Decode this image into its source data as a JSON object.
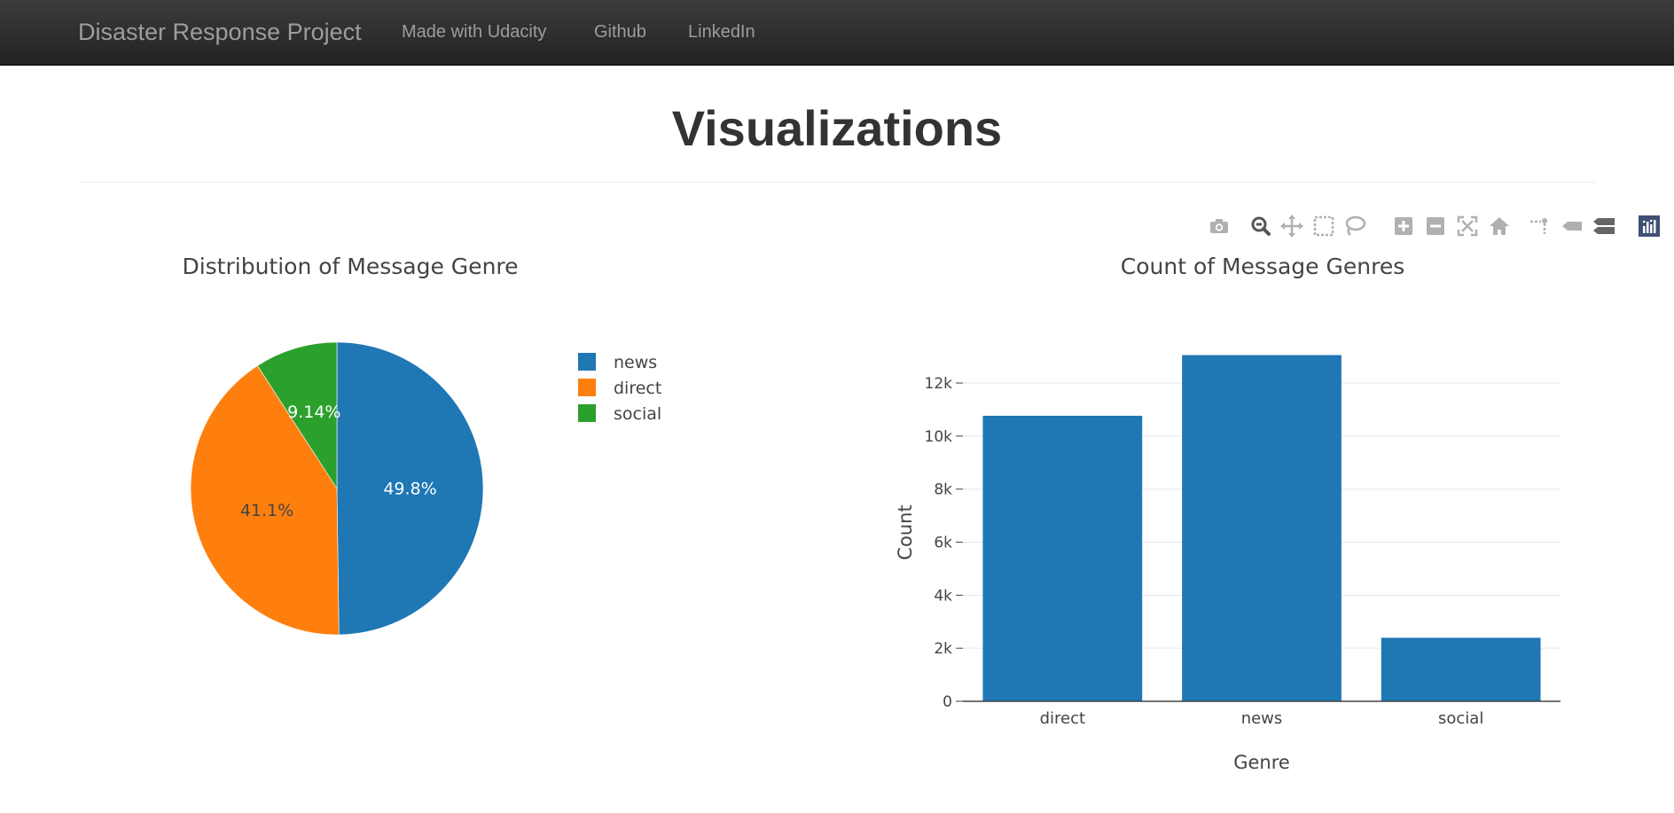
{
  "navbar": {
    "brand": "Disaster Response Project",
    "links": [
      "Made with Udacity",
      "Github",
      "LinkedIn"
    ]
  },
  "page": {
    "title": "Visualizations"
  },
  "modebar": {
    "icons": [
      "camera-icon",
      "zoom-icon",
      "pan-icon",
      "box-select-icon",
      "lasso-select-icon",
      "zoom-in-icon",
      "zoom-out-icon",
      "autoscale-icon",
      "reset-axes-icon",
      "spike-lines-icon",
      "hover-closest-icon",
      "hover-compare-icon",
      "plotly-logo-icon"
    ]
  },
  "colors": {
    "news": "#1f77b4",
    "direct": "#ff7f0e",
    "social": "#2ca02c",
    "bar": "#1f77b4",
    "navbar": "#222222"
  },
  "chart_data": [
    {
      "type": "pie",
      "title": "Distribution of Message Genre",
      "labels": [
        "news",
        "direct",
        "social"
      ],
      "values": [
        49.8,
        41.1,
        9.14
      ],
      "percent_labels": [
        "49.8%",
        "41.1%",
        "9.14%"
      ],
      "legend": "right"
    },
    {
      "type": "bar",
      "title": "Count of Message Genres",
      "categories": [
        "direct",
        "news",
        "social"
      ],
      "values": [
        10766,
        13054,
        2396
      ],
      "xlabel": "Genre",
      "ylabel": "Count",
      "yticks": [
        "0",
        "2k",
        "4k",
        "6k",
        "8k",
        "10k",
        "12k"
      ],
      "ylim": [
        0,
        13740
      ],
      "grid": true
    }
  ]
}
